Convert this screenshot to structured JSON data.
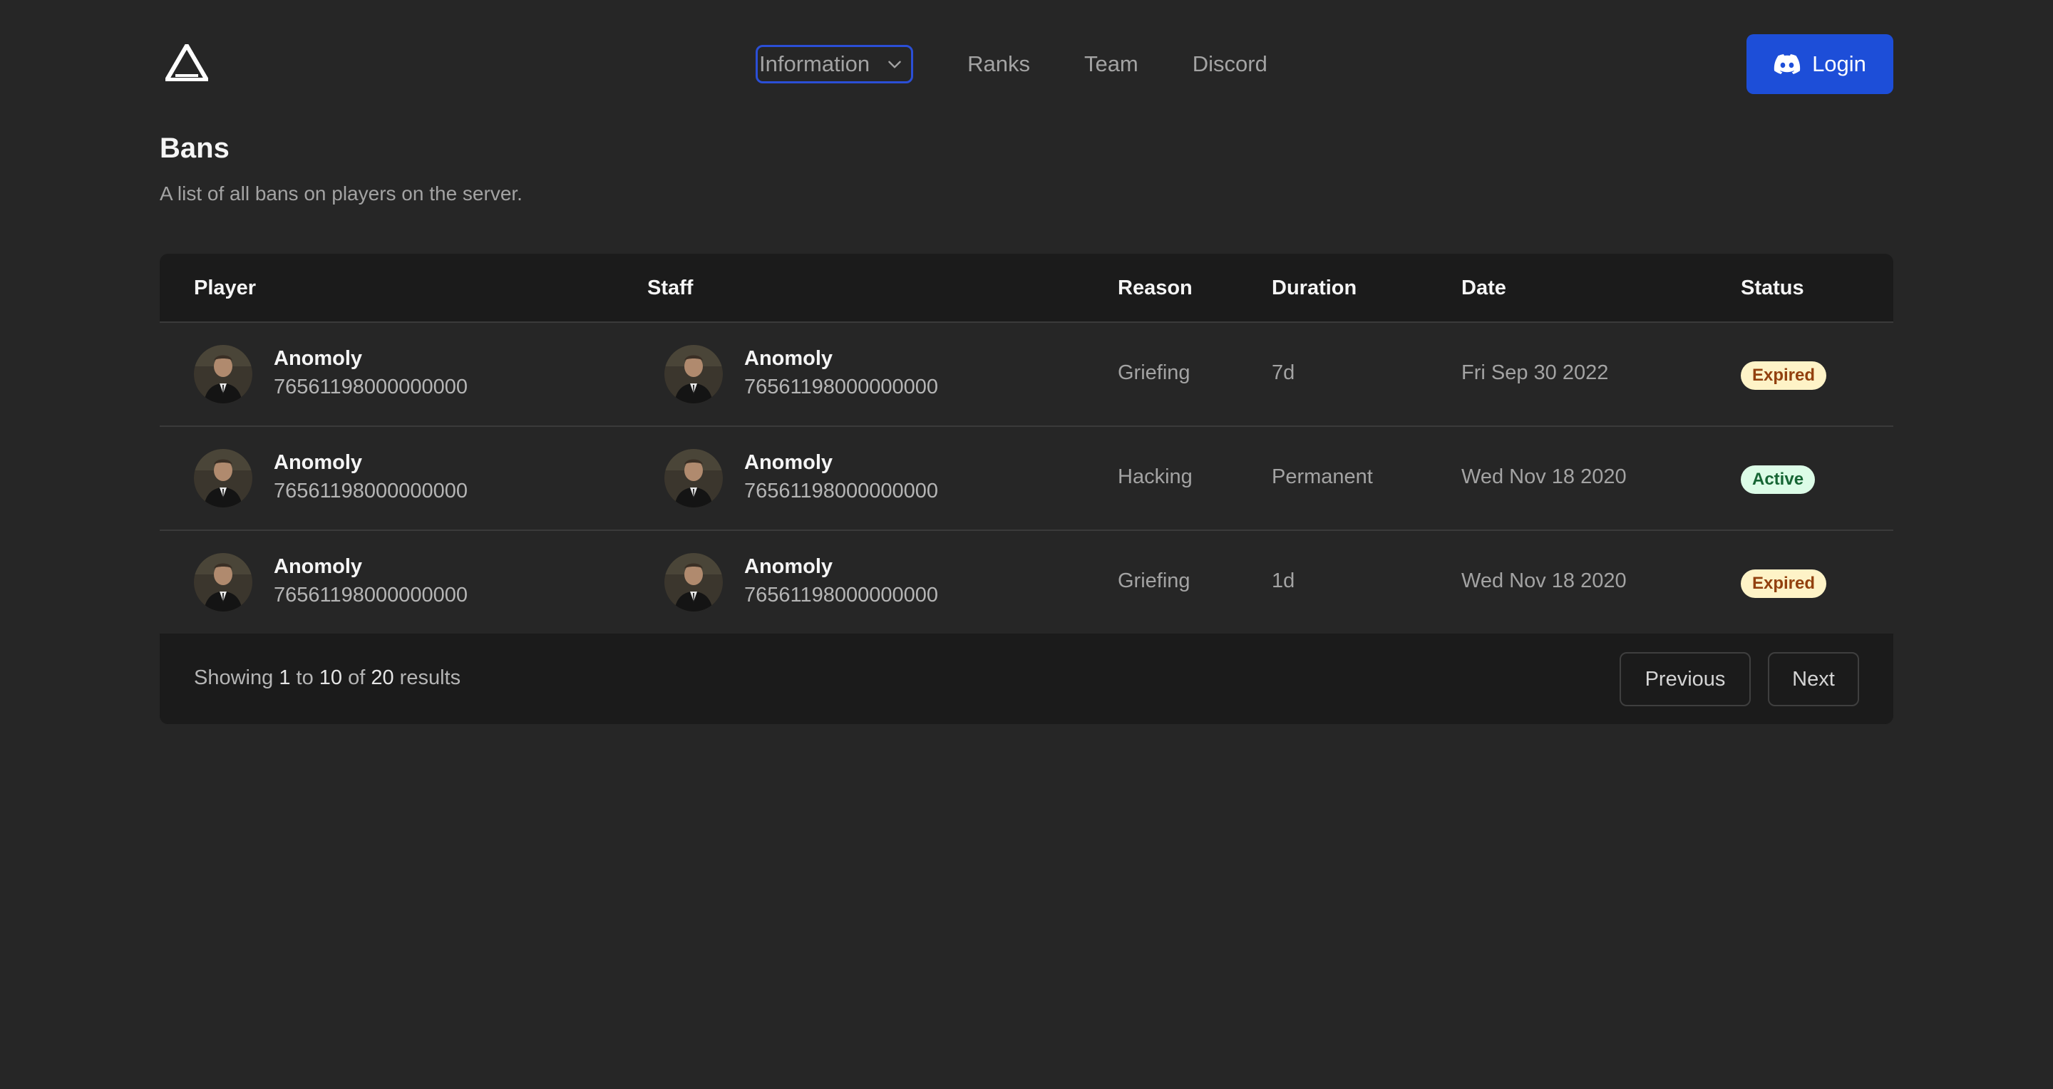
{
  "nav": {
    "dropdown_label": "Information",
    "links": [
      "Ranks",
      "Team",
      "Discord"
    ],
    "login_label": "Login",
    "accent": "#1d4ed8"
  },
  "page": {
    "title": "Bans",
    "subtitle": "A list of all bans on players on the server."
  },
  "table": {
    "headers": {
      "player": "Player",
      "staff": "Staff",
      "reason": "Reason",
      "duration": "Duration",
      "date": "Date",
      "status": "Status"
    },
    "rows": [
      {
        "player_name": "Anomoly",
        "player_id": "76561198000000000",
        "staff_name": "Anomoly",
        "staff_id": "76561198000000000",
        "reason": "Griefing",
        "duration": "7d",
        "date": "Fri Sep 30 2022",
        "status": "Expired"
      },
      {
        "player_name": "Anomoly",
        "player_id": "76561198000000000",
        "staff_name": "Anomoly",
        "staff_id": "76561198000000000",
        "reason": "Hacking",
        "duration": "Permanent",
        "date": "Wed Nov 18 2020",
        "status": "Active"
      },
      {
        "player_name": "Anomoly",
        "player_id": "76561198000000000",
        "staff_name": "Anomoly",
        "staff_id": "76561198000000000",
        "reason": "Griefing",
        "duration": "1d",
        "date": "Wed Nov 18 2020",
        "status": "Expired"
      }
    ]
  },
  "pagination": {
    "prefix": "Showing",
    "from": "1",
    "to_word": "to",
    "to": "10",
    "of_word": "of",
    "total": "20",
    "suffix": "results",
    "previous_label": "Previous",
    "next_label": "Next"
  },
  "icons": {
    "logo": "triangle-logo-icon",
    "dropdown": "chevron-down-icon",
    "login": "discord-icon"
  }
}
